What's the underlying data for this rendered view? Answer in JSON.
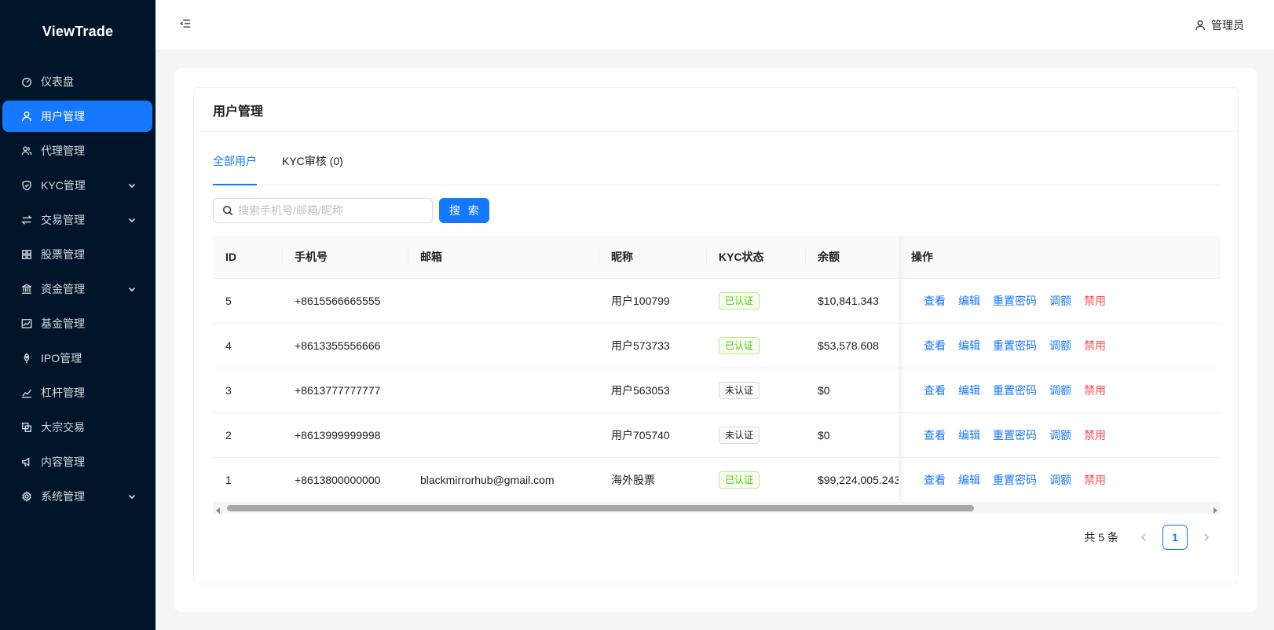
{
  "app": {
    "logo": "ViewTrade"
  },
  "sidebar": {
    "items": [
      {
        "label": "仪表盘",
        "icon": "dashboard-icon",
        "active": false,
        "expandable": false
      },
      {
        "label": "用户管理",
        "icon": "user-icon",
        "active": true,
        "expandable": false
      },
      {
        "label": "代理管理",
        "icon": "team-icon",
        "active": false,
        "expandable": false
      },
      {
        "label": "KYC管理",
        "icon": "shield-icon",
        "active": false,
        "expandable": true
      },
      {
        "label": "交易管理",
        "icon": "swap-icon",
        "active": false,
        "expandable": true
      },
      {
        "label": "股票管理",
        "icon": "grid-icon",
        "active": false,
        "expandable": false
      },
      {
        "label": "资金管理",
        "icon": "bank-icon",
        "active": false,
        "expandable": true
      },
      {
        "label": "基金管理",
        "icon": "fund-icon",
        "active": false,
        "expandable": false
      },
      {
        "label": "IPO管理",
        "icon": "rocket-icon",
        "active": false,
        "expandable": false
      },
      {
        "label": "杠杆管理",
        "icon": "stock-icon",
        "active": false,
        "expandable": false
      },
      {
        "label": "大宗交易",
        "icon": "block-icon",
        "active": false,
        "expandable": false
      },
      {
        "label": "内容管理",
        "icon": "notification-icon",
        "active": false,
        "expandable": false
      },
      {
        "label": "系统管理",
        "icon": "gear-icon",
        "active": false,
        "expandable": true
      }
    ]
  },
  "header": {
    "user_label": "管理员"
  },
  "page": {
    "title": "用户管理",
    "tabs": [
      {
        "label": "全部用户",
        "active": true
      },
      {
        "label": "KYC审核 (0)",
        "active": false
      }
    ],
    "search": {
      "placeholder": "搜索手机号/邮箱/昵称",
      "value": "",
      "button_label": "搜 索"
    }
  },
  "table": {
    "columns": [
      "ID",
      "手机号",
      "邮箱",
      "昵称",
      "KYC状态",
      "余额",
      "操作"
    ],
    "actions": [
      "查看",
      "编辑",
      "重置密码",
      "调额",
      "禁用"
    ],
    "rows": [
      {
        "id": "5",
        "phone": "+8615566665555",
        "email": "",
        "nickname": "用户100799",
        "kyc": "已认证",
        "kyc_ok": true,
        "balance": "$10,841.343"
      },
      {
        "id": "4",
        "phone": "+8613355556666",
        "email": "",
        "nickname": "用户573733",
        "kyc": "已认证",
        "kyc_ok": true,
        "balance": "$53,578.608"
      },
      {
        "id": "3",
        "phone": "+8613777777777",
        "email": "",
        "nickname": "用户563053",
        "kyc": "未认证",
        "kyc_ok": false,
        "balance": "$0"
      },
      {
        "id": "2",
        "phone": "+8613999999998",
        "email": "",
        "nickname": "用户705740",
        "kyc": "未认证",
        "kyc_ok": false,
        "balance": "$0"
      },
      {
        "id": "1",
        "phone": "+8613800000000",
        "email": "blackmirrorhub@gmail.com",
        "nickname": "海外股票",
        "kyc": "已认证",
        "kyc_ok": true,
        "balance": "$99,224,005.243"
      }
    ]
  },
  "pagination": {
    "total_label": "共 5 条",
    "current_page": "1"
  },
  "colors": {
    "primary": "#1677ff",
    "sidebar_bg": "#001529",
    "danger": "#ff4d4f",
    "success": "#52c41a"
  }
}
